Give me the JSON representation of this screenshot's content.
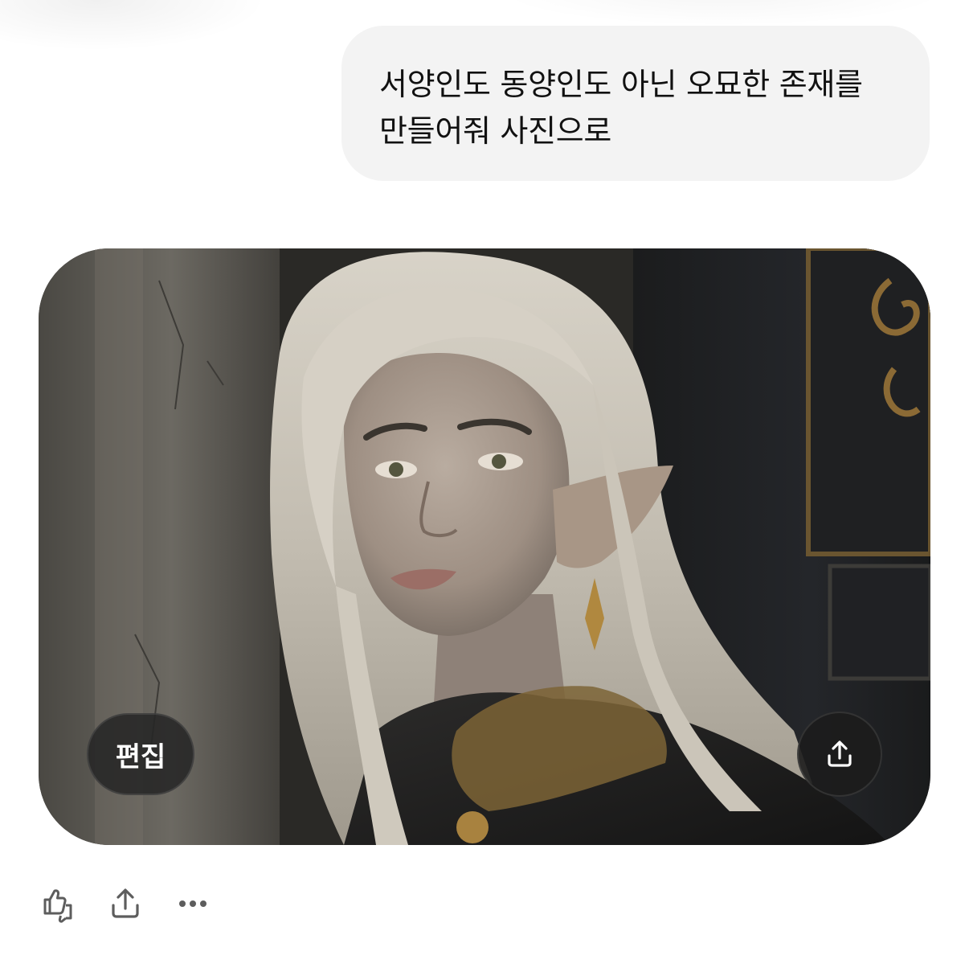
{
  "conversation": {
    "user_message": {
      "lines": [
        "서양인도 동양인도 아닌 오묘한 존재를",
        "만들어줘 사진으로"
      ]
    },
    "generated_image": {
      "subject": "pale-haired elf portrait",
      "edit_label": "편집",
      "share_icon": "share-icon"
    },
    "actions": {
      "feedback_icon": "thumbs-up-down-icon",
      "share_icon": "share-icon",
      "more_icon": "more-horizontal-icon"
    }
  },
  "colors": {
    "bubble_bg": "#f3f3f3",
    "text": "#111111",
    "overlay_button": "#262626",
    "icon": "#5d5d5d"
  }
}
